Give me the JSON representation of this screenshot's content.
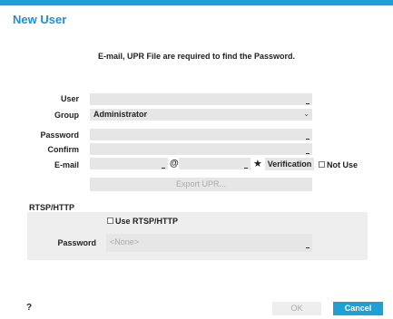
{
  "dialog": {
    "title": "New User",
    "notice": "E-mail, UPR File are required to find the Password."
  },
  "form": {
    "user_label": "User",
    "user_value": "",
    "group_label": "Group",
    "group_value": "Administrator",
    "password_label": "Password",
    "password_value": "",
    "confirm_label": "Confirm",
    "confirm_value": "",
    "email_label": "E-mail",
    "email_local": "",
    "email_at": "@",
    "email_domain": "",
    "verification_label": "Verification",
    "not_use_label": "Not Use",
    "export_upr_label": "Export UPR..."
  },
  "rtsp": {
    "section_title": "RTSP/HTTP",
    "use_label": "Use RTSP/HTTP",
    "password_label": "Password",
    "password_value": "<None>"
  },
  "footer": {
    "help_label": "?",
    "ok_label": "OK",
    "cancel_label": "Cancel"
  },
  "colors": {
    "accent": "#1e9fd6",
    "field_bg": "#e6e6e6",
    "panel_bg": "#eeeeee"
  }
}
